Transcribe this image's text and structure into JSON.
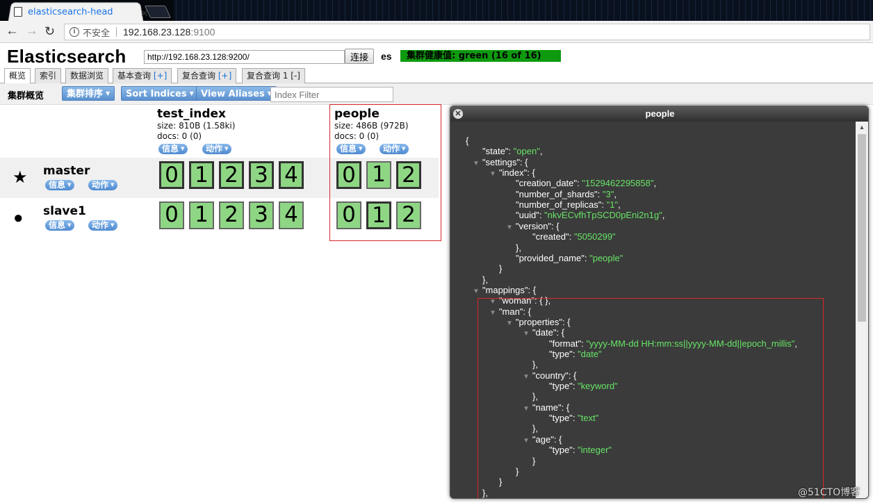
{
  "browser": {
    "tab_title": "elasticsearch-head",
    "security_label": "不安全",
    "url_host": "192.168.23.128",
    "url_port": ":9100"
  },
  "app": {
    "title": "Elasticsearch",
    "server_url": "http://192.168.23.128:9200/",
    "connect_label": "连接",
    "cluster_name": "es",
    "cluster_health": "集群健康值: green (16 of 16)",
    "tabs": [
      {
        "label": "概览",
        "plus": ""
      },
      {
        "label": "索引",
        "plus": ""
      },
      {
        "label": "数据浏览",
        "plus": ""
      },
      {
        "label": "基本查询",
        "plus": "[+]"
      },
      {
        "label": "复合查询",
        "plus": "[+]"
      },
      {
        "label": "复合查询 1",
        "plus": "[-]"
      }
    ]
  },
  "toolbar": {
    "overview_label": "集群概览",
    "sort_cluster": "集群排序",
    "sort_indices": "Sort Indices",
    "view_aliases": "View Aliases",
    "index_filter_placeholder": "Index Filter"
  },
  "indices": [
    {
      "name": "test_index",
      "size": "size: 810B (1.58ki)",
      "docs": "docs: 0 (0)",
      "info": "信息",
      "action": "动作"
    },
    {
      "name": "people",
      "size": "size: 486B (972B)",
      "docs": "docs: 0 (0)",
      "info": "信息",
      "action": "动作"
    }
  ],
  "nodes": [
    {
      "name": "master",
      "icon": "star-icon",
      "info": "信息",
      "action": "动作",
      "test_index_shards": [
        "0",
        "1",
        "2",
        "3",
        "4"
      ],
      "people_shards": [
        "0",
        "1",
        "2"
      ]
    },
    {
      "name": "slave1",
      "icon": "circle-icon",
      "info": "信息",
      "action": "动作",
      "test_index_shards": [
        "0",
        "1",
        "2",
        "3",
        "4"
      ],
      "people_shards": [
        "0",
        "1",
        "2"
      ]
    }
  ],
  "dialog": {
    "title": "people",
    "lines": [
      {
        "depth": 0,
        "tri": false,
        "text": "{"
      },
      {
        "depth": 1,
        "tri": false,
        "key": "\"state\"",
        "val": "\"open\"",
        "tail": ","
      },
      {
        "depth": 1,
        "tri": true,
        "key": "\"settings\"",
        "text": ": {"
      },
      {
        "depth": 2,
        "tri": true,
        "key": "\"index\"",
        "text": ": {"
      },
      {
        "depth": 3,
        "tri": false,
        "key": "\"creation_date\"",
        "val": "\"1529462295858\"",
        "tail": ","
      },
      {
        "depth": 3,
        "tri": false,
        "key": "\"number_of_shards\"",
        "val": "\"3\"",
        "tail": ","
      },
      {
        "depth": 3,
        "tri": false,
        "key": "\"number_of_replicas\"",
        "val": "\"1\"",
        "tail": ","
      },
      {
        "depth": 3,
        "tri": false,
        "key": "\"uuid\"",
        "val": "\"nkvECvfhTpSCD0pEni2n1g\"",
        "tail": ","
      },
      {
        "depth": 3,
        "tri": true,
        "key": "\"version\"",
        "text": ": {"
      },
      {
        "depth": 4,
        "tri": false,
        "key": "\"created\"",
        "val": "\"5050299\"",
        "tail": ""
      },
      {
        "depth": 3,
        "tri": false,
        "text": "},"
      },
      {
        "depth": 3,
        "tri": false,
        "key": "\"provided_name\"",
        "val": "\"people\"",
        "tail": ""
      },
      {
        "depth": 2,
        "tri": false,
        "text": "}"
      },
      {
        "depth": 1,
        "tri": false,
        "text": "},"
      },
      {
        "depth": 1,
        "tri": true,
        "key": "\"mappings\"",
        "text": ": {"
      },
      {
        "depth": 2,
        "tri": true,
        "key": "\"woman\"",
        "text": ": { },"
      },
      {
        "depth": 2,
        "tri": true,
        "key": "\"man\"",
        "text": ": {"
      },
      {
        "depth": 3,
        "tri": true,
        "key": "\"properties\"",
        "text": ": {"
      },
      {
        "depth": 4,
        "tri": true,
        "key": "\"date\"",
        "text": ": {"
      },
      {
        "depth": 5,
        "tri": false,
        "key": "\"format\"",
        "val": "\"yyyy-MM-dd HH:mm:ss||yyyy-MM-dd||epoch_millis\"",
        "tail": ","
      },
      {
        "depth": 5,
        "tri": false,
        "key": "\"type\"",
        "val": "\"date\"",
        "tail": ""
      },
      {
        "depth": 4,
        "tri": false,
        "text": "},"
      },
      {
        "depth": 4,
        "tri": true,
        "key": "\"country\"",
        "text": ": {"
      },
      {
        "depth": 5,
        "tri": false,
        "key": "\"type\"",
        "val": "\"keyword\"",
        "tail": ""
      },
      {
        "depth": 4,
        "tri": false,
        "text": "},"
      },
      {
        "depth": 4,
        "tri": true,
        "key": "\"name\"",
        "text": ": {"
      },
      {
        "depth": 5,
        "tri": false,
        "key": "\"type\"",
        "val": "\"text\"",
        "tail": ""
      },
      {
        "depth": 4,
        "tri": false,
        "text": "},"
      },
      {
        "depth": 4,
        "tri": true,
        "key": "\"age\"",
        "text": ": {"
      },
      {
        "depth": 5,
        "tri": false,
        "key": "\"type\"",
        "val": "\"integer\"",
        "tail": ""
      },
      {
        "depth": 4,
        "tri": false,
        "text": "}"
      },
      {
        "depth": 3,
        "tri": false,
        "text": "}"
      },
      {
        "depth": 2,
        "tri": false,
        "text": "}"
      },
      {
        "depth": 1,
        "tri": false,
        "text": "},"
      }
    ]
  },
  "watermark": "@51CTO博客",
  "colors": {
    "health_green": "#0e9a0e",
    "shard_green": "#8ed684",
    "json_string": "#67e567",
    "highlight_red": "#d9262b"
  }
}
